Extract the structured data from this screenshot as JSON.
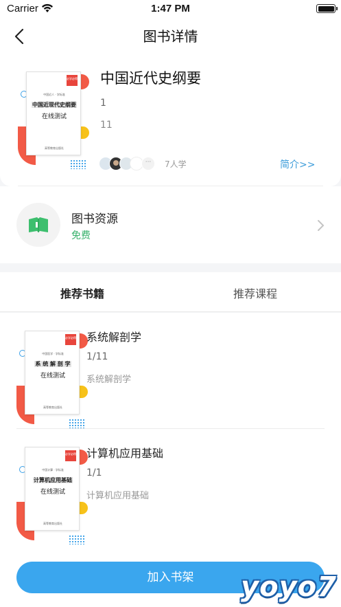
{
  "status_bar": {
    "carrier": "Carrier",
    "time": "1:47 PM"
  },
  "nav": {
    "title": "图书详情"
  },
  "book": {
    "title": "中国近代史纲要",
    "meta_1": "1",
    "meta_2": "11",
    "learners": "7人学",
    "intro_link": "简介>>",
    "cover": {
      "badge": "必学必得",
      "small_line": "中国近人 · 学标准",
      "title": "中国近现代史纲要",
      "subtitle": "在线测试",
      "publisher": "高等教育出版社"
    }
  },
  "resource": {
    "title": "图书资源",
    "price": "免费"
  },
  "tabs": [
    {
      "label": "推荐书籍",
      "active": true
    },
    {
      "label": "推荐课程",
      "active": false
    }
  ],
  "recommended_books": [
    {
      "title": "系统解剖学",
      "count": "1/11",
      "desc": "系统解剖学",
      "cover": {
        "badge": "必学必得",
        "small_line": "中国医学 · 学标准",
        "title": "系 统 解 剖 学",
        "subtitle": "在线测试",
        "publisher": "高等教育出版社"
      }
    },
    {
      "title": "计算机应用基础",
      "count": "1/1",
      "desc": "计算机应用基础",
      "cover": {
        "badge": "必学必得",
        "small_line": "中国计算 · 学标准",
        "title": "计算机应用基础",
        "subtitle": "在线测试",
        "publisher": "高等教育出版社"
      }
    }
  ],
  "bottom": {
    "add_to_shelf": "加入书架"
  },
  "watermark": "yoyo7",
  "colors": {
    "accent": "#3aa6ee",
    "free_green": "#38b26c",
    "link_blue": "#3a9bd9",
    "cover_red": "#f25a46",
    "cover_yellow": "#f7c21a"
  }
}
